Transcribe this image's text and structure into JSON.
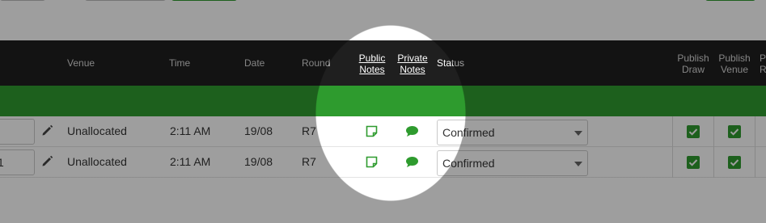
{
  "header": {
    "venue": "Venue",
    "time": "Time",
    "date": "Date",
    "round": "Round",
    "public_notes": [
      "Public",
      "Notes"
    ],
    "private_notes": [
      "Private",
      "Notes"
    ],
    "status": "Status",
    "publish_draw": [
      "Publish",
      "Draw"
    ],
    "publish_venue": [
      "Publish",
      "Venue"
    ],
    "publish_cut": [
      "P",
      "R"
    ]
  },
  "rows": [
    {
      "field_partial": "",
      "venue": "Unallocated",
      "time": "2:11 AM",
      "date": "19/08",
      "round": "R7",
      "status": "Confirmed",
      "publish_draw": true,
      "publish_venue": true
    },
    {
      "field_partial": "1",
      "venue": "Unallocated",
      "time": "2:11 AM",
      "date": "19/08",
      "round": "R7",
      "status": "Confirmed",
      "publish_draw": true,
      "publish_venue": true
    }
  ],
  "icons": {
    "edit": "pencil-icon",
    "public_note": "note-icon",
    "private_note": "chat-bubble-icon",
    "dropdown": "chevron-down-icon",
    "checkbox": "check-icon"
  },
  "colors": {
    "accent_green": "#2e9b2e",
    "header_bg": "#1f1f1f",
    "spotlight_dim": "rgba(0,0,0,0.38)"
  }
}
